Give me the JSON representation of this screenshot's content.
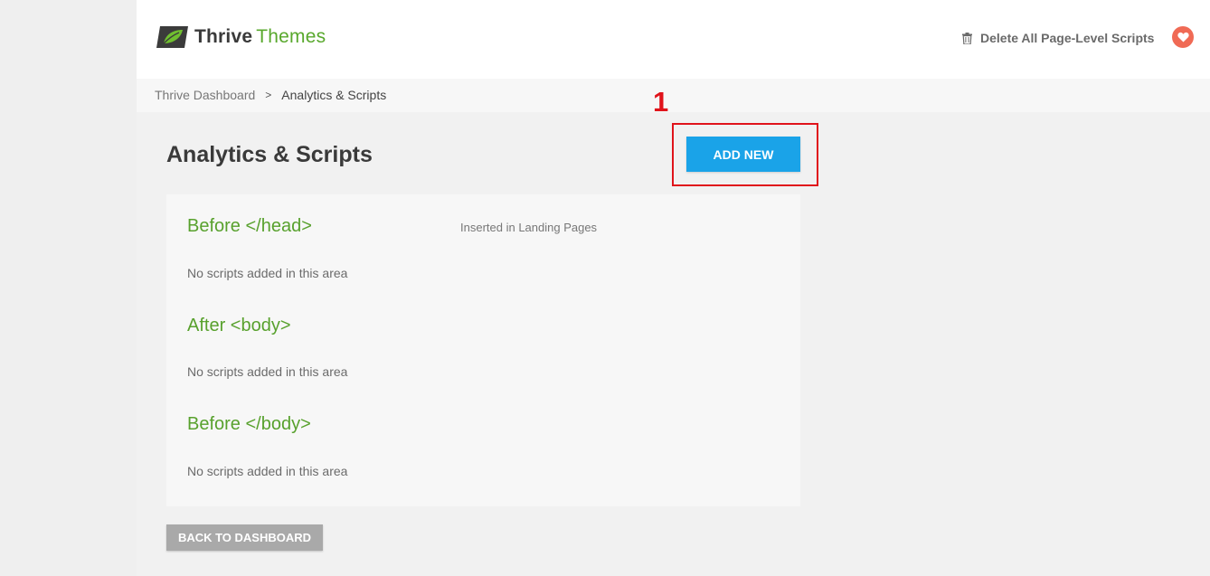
{
  "header": {
    "logo_word_1": "Thrive",
    "logo_word_2": "Themes",
    "delete_label": "Delete All Page-Level Scripts",
    "brand_green": "#58a82c",
    "heart_color": "#f06a55"
  },
  "breadcrumb": {
    "root": "Thrive Dashboard",
    "separator": ">",
    "current": "Analytics & Scripts"
  },
  "annotation": {
    "number": "1",
    "color": "#e0131b"
  },
  "main": {
    "title": "Analytics & Scripts",
    "add_new_label": "ADD NEW",
    "inserted_note": "Inserted in Landing Pages",
    "sections": [
      {
        "title": "Before </head>",
        "empty_text": "No scripts added in this area"
      },
      {
        "title": "After <body>",
        "empty_text": "No scripts added in this area"
      },
      {
        "title": "Before </body>",
        "empty_text": "No scripts added in this area"
      }
    ],
    "back_label": "BACK TO DASHBOARD",
    "accent": "#1aa3e8"
  }
}
